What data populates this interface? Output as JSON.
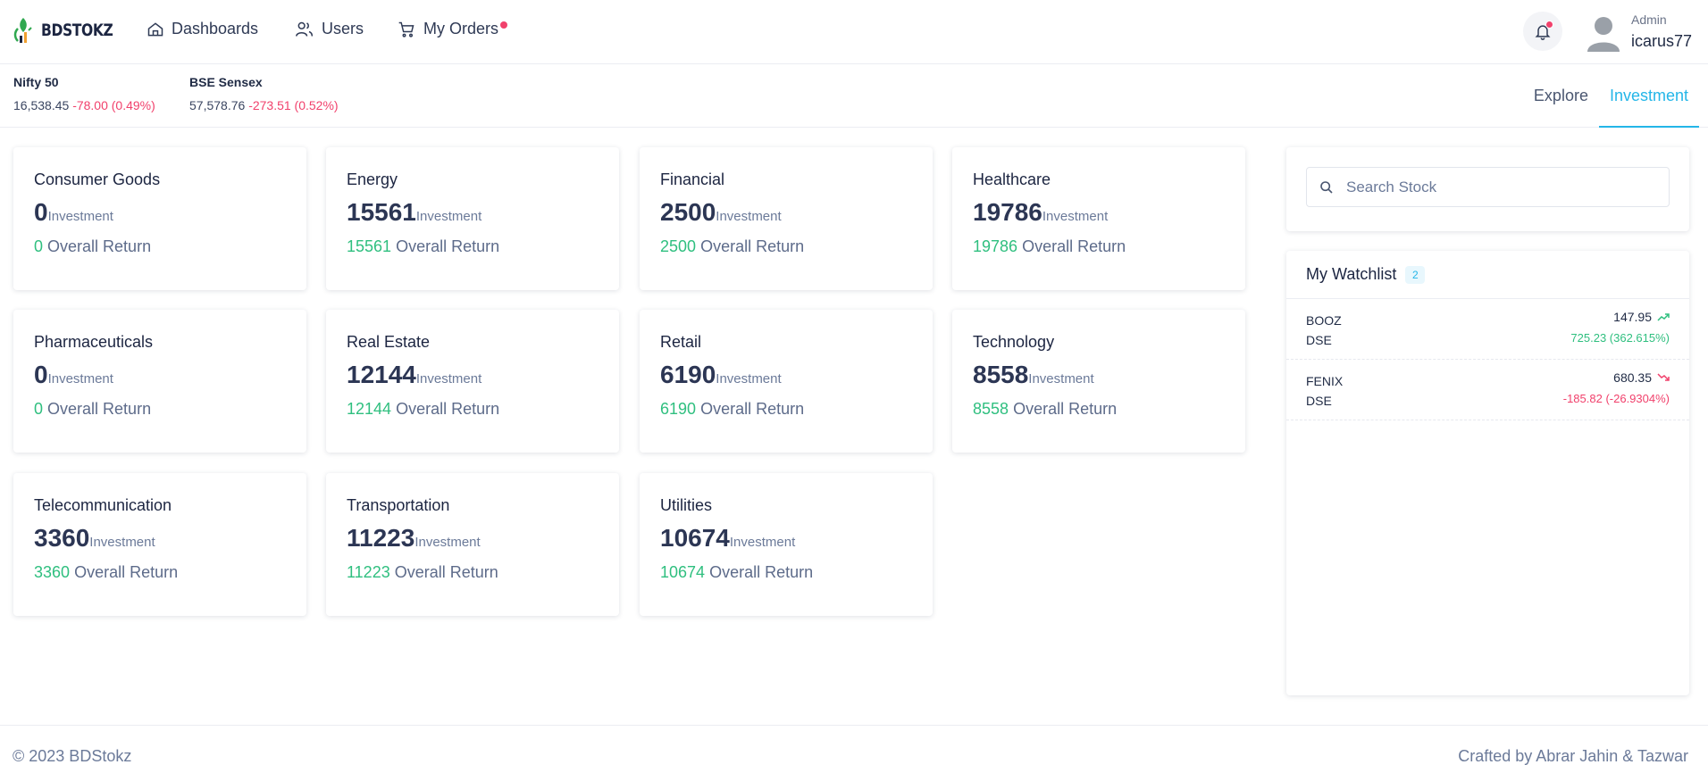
{
  "brand": {
    "name": "BDSTOKZ"
  },
  "nav": {
    "items": [
      {
        "label": "Dashboards",
        "icon": "home-icon"
      },
      {
        "label": "Users",
        "icon": "users-icon"
      },
      {
        "label": "My Orders",
        "icon": "cart-icon",
        "has_notification": true
      }
    ]
  },
  "user": {
    "role": "Admin",
    "username": "icarus77"
  },
  "tickers": [
    {
      "name": "Nifty 50",
      "value": "16,538.45",
      "change": "-78.00 (0.49%)"
    },
    {
      "name": "BSE Sensex",
      "value": "57,578.76",
      "change": "-273.51 (0.52%)"
    }
  ],
  "tabs": [
    {
      "label": "Explore",
      "active": false
    },
    {
      "label": "Investment",
      "active": true
    }
  ],
  "sectors": [
    {
      "name": "Consumer Goods",
      "investment": "0",
      "return": "0"
    },
    {
      "name": "Energy",
      "investment": "15561",
      "return": "15561"
    },
    {
      "name": "Financial",
      "investment": "2500",
      "return": "2500"
    },
    {
      "name": "Healthcare",
      "investment": "19786",
      "return": "19786"
    },
    {
      "name": "Pharmaceuticals",
      "investment": "0",
      "return": "0"
    },
    {
      "name": "Real Estate",
      "investment": "12144",
      "return": "12144"
    },
    {
      "name": "Retail",
      "investment": "6190",
      "return": "6190"
    },
    {
      "name": "Technology",
      "investment": "8558",
      "return": "8558"
    },
    {
      "name": "Telecommunication",
      "investment": "3360",
      "return": "3360"
    },
    {
      "name": "Transportation",
      "investment": "11223",
      "return": "11223"
    },
    {
      "name": "Utilities",
      "investment": "10674",
      "return": "10674"
    }
  ],
  "labels": {
    "investment": "Investment",
    "overall_return": "Overall Return"
  },
  "search": {
    "placeholder": "Search Stock",
    "value": ""
  },
  "watchlist": {
    "title": "My Watchlist",
    "count": "2",
    "items": [
      {
        "symbol": "BOOZ",
        "exchange": "DSE",
        "price": "147.95",
        "change": "725.23 (362.615%)",
        "direction": "up"
      },
      {
        "symbol": "FENIX",
        "exchange": "DSE",
        "price": "680.35",
        "change": "-185.82 (-26.9304%)",
        "direction": "down"
      }
    ]
  },
  "footer": {
    "copyright": "© 2023 BDStokz",
    "credits": "Crafted by Abrar Jahin & Tazwar"
  },
  "colors": {
    "accent": "#24b6e8",
    "positive": "#2fbf7f",
    "negative": "#f1416c",
    "brand_green": "#2fa84f"
  }
}
